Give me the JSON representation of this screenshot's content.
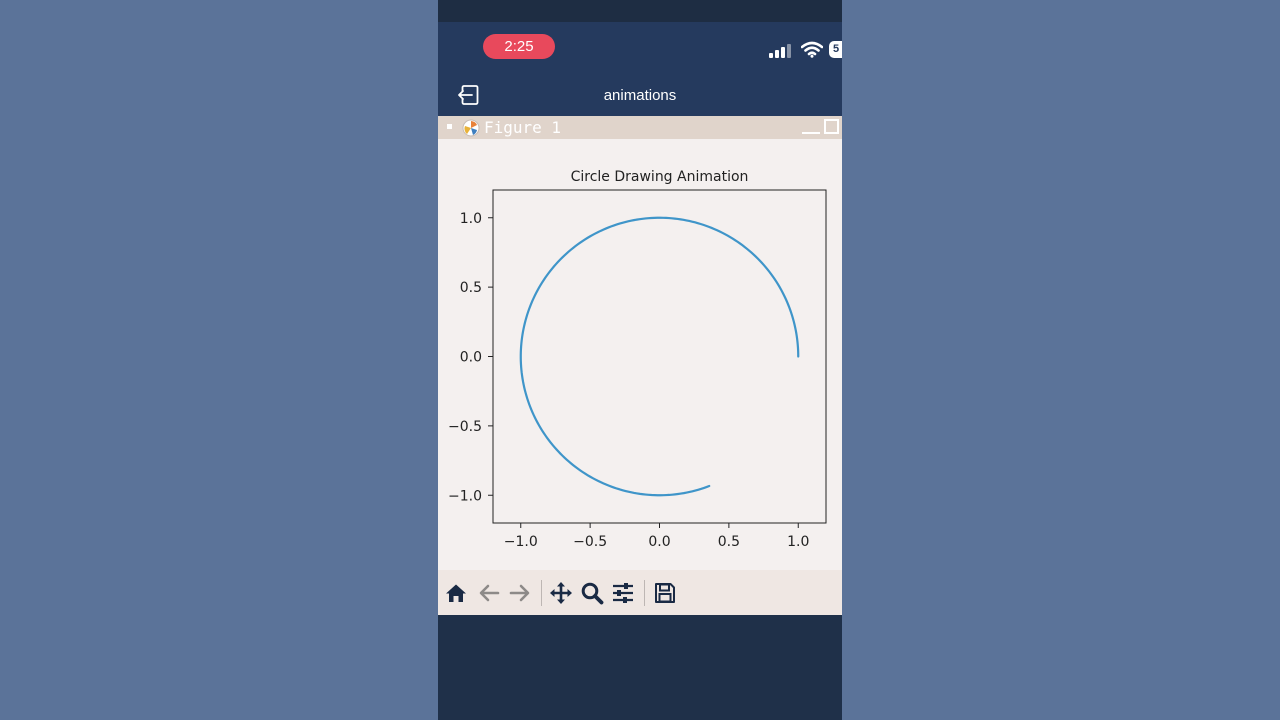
{
  "status_bar": {
    "time": "2:25",
    "battery": "5"
  },
  "nav": {
    "title": "animations",
    "back_icon": "exit-arrow-icon"
  },
  "window": {
    "title": "Figure 1"
  },
  "toolbar": {
    "buttons": [
      "home-icon",
      "back-arrow-icon",
      "forward-arrow-icon",
      "pan-icon",
      "zoom-icon",
      "configure-subplots-icon",
      "save-icon"
    ]
  },
  "colors": {
    "line": "#3f95c9",
    "status_pill": "#e8495c",
    "nav_background": "#253a5e",
    "figure_background": "#f4f0ef"
  },
  "chart_data": {
    "type": "line",
    "title": "Circle Drawing Animation",
    "xlabel": "",
    "ylabel": "",
    "xlim": [
      -1.2,
      1.2
    ],
    "ylim": [
      -1.2,
      1.2
    ],
    "xticks": [
      -1.0,
      -0.5,
      0.0,
      0.5,
      1.0
    ],
    "xtick_labels": [
      "−1.0",
      "−0.5",
      "0.0",
      "0.5",
      "1.0"
    ],
    "yticks": [
      1.0,
      0.5,
      0.0,
      -0.5,
      -1.0
    ],
    "ytick_labels": [
      "1.0",
      "0.5",
      "0.0",
      "−0.5",
      "−1.0"
    ],
    "grid": false,
    "series": [
      {
        "parametric": "x = cos(t), y = sin(t)",
        "t_start_deg": 0,
        "t_end_deg": 291,
        "start_point": [
          1.0,
          0.0
        ],
        "end_point": [
          0.36,
          -0.93
        ]
      }
    ]
  }
}
